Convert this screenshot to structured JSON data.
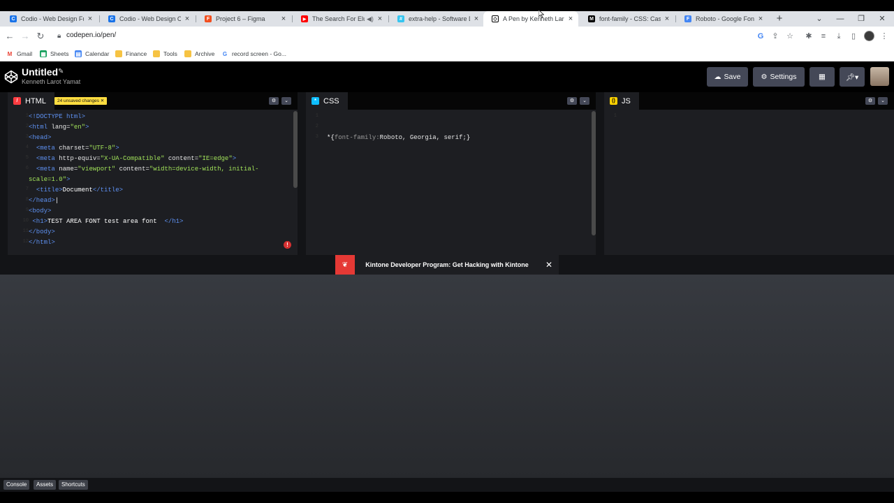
{
  "browser": {
    "tabs": [
      {
        "title": "Codio - Web Design Fund",
        "favicon": "codio-icon",
        "color": "#1a73e8",
        "glyph": "C"
      },
      {
        "title": "Codio - Web Design Com",
        "favicon": "codio-icon",
        "color": "#1a73e8",
        "glyph": "C"
      },
      {
        "title": "Project 6 – Figma",
        "favicon": "figma-icon",
        "color": "#f24e1e",
        "glyph": "F"
      },
      {
        "title": "The Search For Elusive",
        "favicon": "youtube-icon",
        "color": "#ff0000",
        "glyph": "▶"
      },
      {
        "title": "extra-help - Software Dev",
        "favicon": "slack-icon",
        "color": "#36c5f0",
        "glyph": "#"
      },
      {
        "title": "A Pen by Kenneth Larot Ya",
        "favicon": "codepen-icon",
        "color": "#000000",
        "glyph": "◇"
      },
      {
        "title": "font-family - CSS: Cascadi",
        "favicon": "mdn-icon",
        "color": "#000000",
        "glyph": "M"
      },
      {
        "title": "Roboto - Google Fonts",
        "favicon": "google-fonts-icon",
        "color": "#4285f4",
        "glyph": "F"
      }
    ],
    "active_tab": 5,
    "url": "codepen.io/pen/",
    "bookmarks": [
      {
        "label": "Gmail",
        "icon": "gmail-icon"
      },
      {
        "label": "Sheets",
        "icon": "sheets-icon"
      },
      {
        "label": "Calendar",
        "icon": "calendar-icon"
      },
      {
        "label": "Finance",
        "icon": "folder-icon"
      },
      {
        "label": "Tools",
        "icon": "folder-icon"
      },
      {
        "label": "Archive",
        "icon": "folder-icon"
      },
      {
        "label": "record screen - Go...",
        "icon": "google-icon"
      }
    ]
  },
  "codepen": {
    "title": "Untitled",
    "author": "Kenneth Larot Yamat",
    "save_label": "Save",
    "settings_label": "Settings",
    "editors": {
      "html": {
        "label": "HTML",
        "unsaved": "24 unsaved changes ✕",
        "line_numbers": [
          "1",
          "2",
          "3",
          "4",
          "5",
          "6",
          "",
          "7",
          "8",
          "9",
          "10",
          "11",
          "12"
        ]
      },
      "css": {
        "label": "CSS",
        "line_numbers": [
          "1",
          "2",
          "3"
        ]
      },
      "js": {
        "label": "JS",
        "line_numbers": [
          "1"
        ]
      }
    },
    "ad_text": "Kintone Developer Program: Get Hacking with Kintone",
    "footer": {
      "console": "Console",
      "assets": "Assets",
      "shortcuts": "Shortcuts"
    }
  },
  "colors": {
    "html_accent": "#ff3c41",
    "css_accent": "#0ebeff",
    "js_accent": "#fcd000",
    "unsaved_badge": "#ffdd40"
  }
}
